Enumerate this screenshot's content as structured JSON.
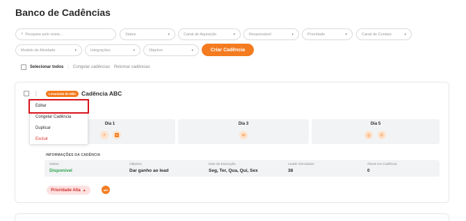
{
  "page": {
    "title": "Banco de Cadências"
  },
  "filters": {
    "search_placeholder": "Pesquise pelo nome...",
    "status": "Status",
    "canal_aquisicao": "Canal de Aquisição",
    "responsavel": "Responsável",
    "prioridade": "Prioridade",
    "canal_contato": "Canal de Contato",
    "modelo_atividade": "Modelo de Atividade",
    "integracoes": "Integrações",
    "objetivo": "Objetivo",
    "create_button": "Criar Cadência"
  },
  "bulk": {
    "select_all": "Selecionar todos",
    "freeze": "Congelar cadências",
    "resume": "Retomar cadências"
  },
  "card": {
    "tag": "Levantada de Mão",
    "name": "Cadência ABC",
    "menu": [
      "Editar",
      "Congelar Cadência",
      "Duplicar",
      "Excluir"
    ],
    "days": [
      {
        "label": "Dia 1",
        "icons": [
          "search-icon",
          "linkedin-icon"
        ]
      },
      {
        "label": "Dia 3",
        "icons": [
          "email-icon"
        ]
      },
      {
        "label": "Dia 5",
        "icons": [
          "whatsapp-icon",
          "phone-icon"
        ]
      }
    ],
    "info_title": "INFORMAÇÕES DA CADÊNCIA",
    "info": {
      "status_k": "Status",
      "status_v": "Disponível",
      "objetivo_k": "Objetivo",
      "objetivo_v": "Dar ganho ao lead",
      "dias_k": "Dias de Execução",
      "dias_v": "Seg, Ter, Qua, Qui, Sex",
      "leads_k": "Leads Vinculados",
      "leads_v": "38",
      "ativos_k": "Ativos em Cadência",
      "ativos_v": "0"
    },
    "priority": "Prioridade Alta",
    "avatar_initials": "MR"
  },
  "colors": {
    "accent": "#f47b20",
    "danger": "#e03131",
    "success": "#2aa34a",
    "highlight": "#d8101a"
  }
}
